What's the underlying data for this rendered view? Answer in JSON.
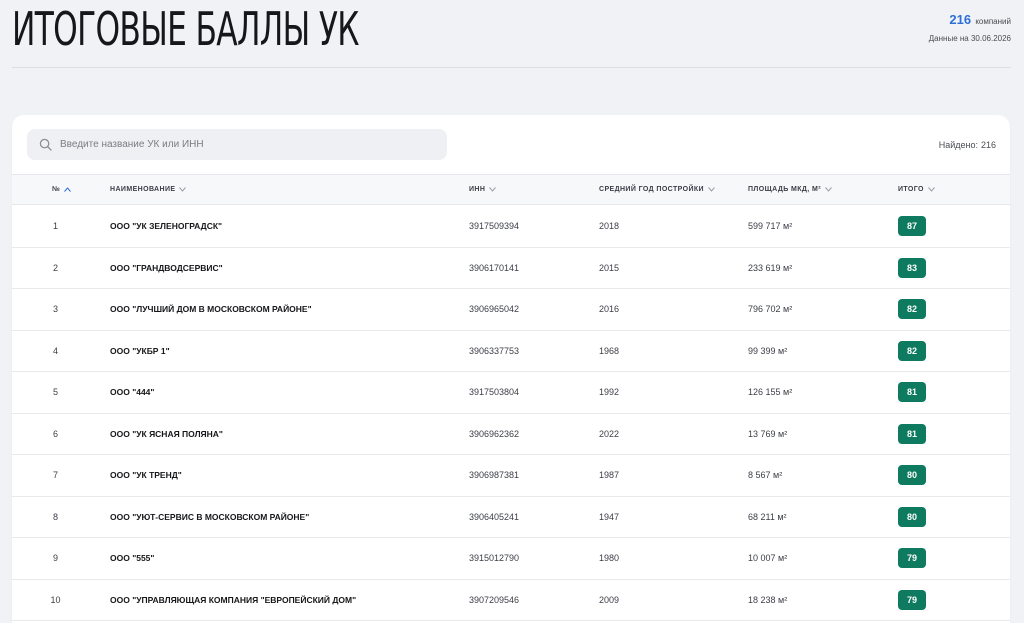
{
  "header": {
    "title": "ИТОГОВЫЕ БАЛЛЫ УК",
    "company_count": "216",
    "company_count_unit": "компаний",
    "data_date": "Данные на 30.06.2026"
  },
  "search": {
    "placeholder": "Введите название УК или ИНН",
    "found_label": "Найдено:",
    "found_count": "216"
  },
  "table": {
    "columns": {
      "num": "№",
      "name": "НАИМЕНОВАНИЕ",
      "inn": "ИНН",
      "year": "СРЕДНИЙ ГОД ПОСТРОЙКИ",
      "area": "ПЛОЩАДЬ МКД, М²",
      "total": "ИТОГО"
    },
    "rows": [
      {
        "num": "1",
        "name": "ООО \"УК ЗЕЛЕНОГРАДСК\"",
        "inn": "3917509394",
        "year": "2018",
        "area": "599 717 м²",
        "total": "87"
      },
      {
        "num": "2",
        "name": "ООО \"ГРАНДВОДСЕРВИС\"",
        "inn": "3906170141",
        "year": "2015",
        "area": "233 619 м²",
        "total": "83"
      },
      {
        "num": "3",
        "name": "ООО \"ЛУЧШИЙ ДОМ В МОСКОВСКОМ РАЙОНЕ\"",
        "inn": "3906965042",
        "year": "2016",
        "area": "796 702 м²",
        "total": "82"
      },
      {
        "num": "4",
        "name": "ООО \"УКБР 1\"",
        "inn": "3906337753",
        "year": "1968",
        "area": "99 399 м²",
        "total": "82"
      },
      {
        "num": "5",
        "name": "ООО \"444\"",
        "inn": "3917503804",
        "year": "1992",
        "area": "126 155 м²",
        "total": "81"
      },
      {
        "num": "6",
        "name": "ООО \"УК ЯСНАЯ ПОЛЯНА\"",
        "inn": "3906962362",
        "year": "2022",
        "area": "13 769 м²",
        "total": "81"
      },
      {
        "num": "7",
        "name": "ООО \"УК ТРЕНД\"",
        "inn": "3906987381",
        "year": "1987",
        "area": "8 567 м²",
        "total": "80"
      },
      {
        "num": "8",
        "name": "ООО \"УЮТ-СЕРВИС В МОСКОВСКОМ РАЙОНЕ\"",
        "inn": "3906405241",
        "year": "1947",
        "area": "68 211 м²",
        "total": "80"
      },
      {
        "num": "9",
        "name": "ООО \"555\"",
        "inn": "3915012790",
        "year": "1980",
        "area": "10 007 м²",
        "total": "79"
      },
      {
        "num": "10",
        "name": "ООО \"УПРАВЛЯЮЩАЯ КОМПАНИЯ \"ЕВРОПЕЙСКИЙ ДОМ\"",
        "inn": "3907209546",
        "year": "2009",
        "area": "18 238 м²",
        "total": "79"
      }
    ]
  },
  "colors": {
    "accent_blue": "#2c6fd6",
    "score_badge": "#0e7a5f",
    "background": "#f1f2f5"
  }
}
